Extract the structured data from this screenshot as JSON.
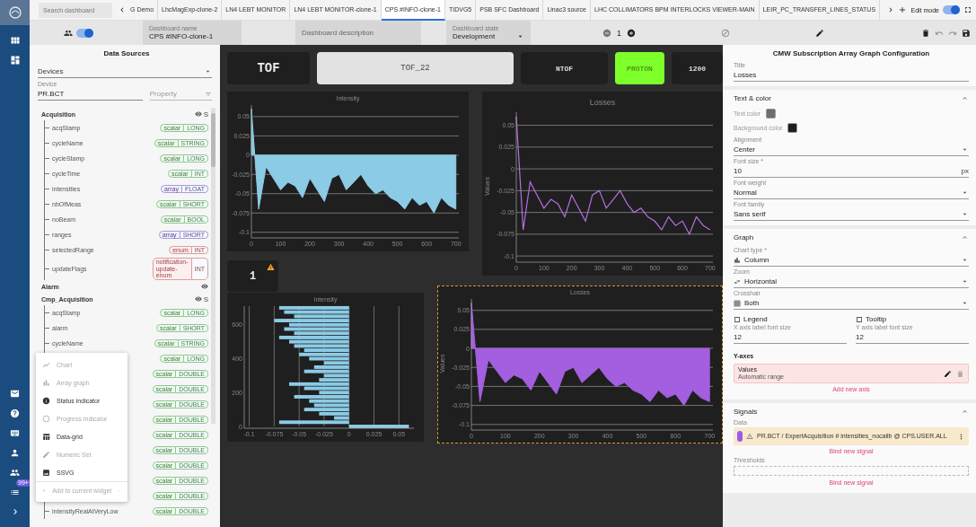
{
  "rail": {
    "badge": "99+"
  },
  "top_bar": {
    "search": {
      "placeholder": "Search dashboard"
    },
    "tabs": [
      {
        "label": "G Demo",
        "selected": false
      },
      {
        "label": "LhcMagExp-clone-2",
        "selected": false
      },
      {
        "label": "LN4 LEBT MONITOR",
        "selected": false
      },
      {
        "label": "LN4 LEBT MONITOR-clone-1",
        "selected": false
      },
      {
        "label": "CPS #INFO-clone-1",
        "selected": true
      },
      {
        "label": "TIDVG5",
        "selected": false
      },
      {
        "label": "PSB SFC Dashboard",
        "selected": false
      },
      {
        "label": "Linac3 source",
        "selected": false
      },
      {
        "label": "LHC COLLIMATORS BPM INTERLOCKS VIEWER-MAIN",
        "selected": false
      },
      {
        "label": "LEIR_PC_TRANSFER_LINES_STATUS",
        "selected": false
      }
    ],
    "edit_mode": {
      "label": "Edit mode",
      "on": true
    }
  },
  "dashboard_bar": {
    "shared": {
      "on": true
    },
    "name": {
      "label": "Dashboard name",
      "value": "CPS #INFO-clone-1"
    },
    "description": {
      "placeholder": "Dashboard description"
    },
    "state": {
      "label": "Dashboard state",
      "value": "Development"
    },
    "counter": "1"
  },
  "data_sources": {
    "title": "Data Sources",
    "source_type": "Devices",
    "device": {
      "label": "Device",
      "value": "PR.BCT"
    },
    "property": {
      "placeholder": "Property"
    },
    "groups": [
      {
        "name": "Acquisition",
        "mark": "S",
        "fields": [
          {
            "name": "acqStamp",
            "shape": "scalar",
            "type": "LONG",
            "kind": "scalar"
          },
          {
            "name": "cycleName",
            "shape": "scalar",
            "type": "STRING",
            "kind": "scalar"
          },
          {
            "name": "cycleStamp",
            "shape": "scalar",
            "type": "LONG",
            "kind": "scalar"
          },
          {
            "name": "cycleTime",
            "shape": "scalar",
            "type": "INT",
            "kind": "scalar"
          },
          {
            "name": "intensities",
            "shape": "array",
            "type": "FLOAT",
            "kind": "array"
          },
          {
            "name": "nbOfMeas",
            "shape": "scalar",
            "type": "SHORT",
            "kind": "scalar"
          },
          {
            "name": "noBeam",
            "shape": "scalar",
            "type": "BOOL",
            "kind": "scalar"
          },
          {
            "name": "ranges",
            "shape": "array",
            "type": "SHORT",
            "kind": "array"
          },
          {
            "name": "selectedRange",
            "shape": "enum",
            "type": "INT",
            "kind": "enum"
          },
          {
            "name": "updateFlags",
            "shape": "notification-update-enum",
            "type": "INT",
            "kind": "enum"
          }
        ]
      },
      {
        "name": "Alarm"
      },
      {
        "name": "Cmp_Acquisition",
        "mark": "S",
        "fields": [
          {
            "name": "acqStamp",
            "shape": "scalar",
            "type": "LONG",
            "kind": "scalar"
          },
          {
            "name": "alarm",
            "shape": "scalar",
            "type": "SHORT",
            "kind": "scalar"
          },
          {
            "name": "cycleName",
            "shape": "scalar",
            "type": "STRING",
            "kind": "scalar"
          },
          {
            "shape": "scalar",
            "type": "LONG",
            "kind": "scalar"
          },
          {
            "shape": "scalar",
            "type": "DOUBLE",
            "kind": "scalar"
          },
          {
            "shape": "scalar",
            "type": "DOUBLE",
            "kind": "scalar"
          },
          {
            "shape": "scalar",
            "type": "DOUBLE",
            "kind": "scalar"
          },
          {
            "shape": "scalar",
            "type": "DOUBLE",
            "kind": "scalar"
          },
          {
            "shape": "scalar",
            "type": "DOUBLE",
            "kind": "scalar"
          },
          {
            "shape": "scalar",
            "type": "DOUBLE",
            "kind": "scalar"
          },
          {
            "shape": "scalar",
            "type": "DOUBLE",
            "kind": "scalar"
          },
          {
            "shape": "scalar",
            "type": "DOUBLE",
            "kind": "scalar"
          },
          {
            "shape": "scalar",
            "type": "DOUBLE",
            "kind": "scalar"
          },
          {
            "name": "intensityRealAtVeryLow",
            "shape": "scalar",
            "type": "DOUBLE",
            "kind": "scalar"
          }
        ]
      }
    ],
    "widget_menu": [
      {
        "label": "Chart",
        "kind": "chart",
        "disabled": true
      },
      {
        "label": "Array graph",
        "kind": "array_graph",
        "disabled": true
      },
      {
        "label": "Status indicator",
        "kind": "status",
        "disabled": false
      },
      {
        "label": "Progress indicator",
        "kind": "progress",
        "disabled": true
      },
      {
        "label": "Data-grid",
        "kind": "grid",
        "disabled": false
      },
      {
        "label": "Numeric Set",
        "kind": "numeric",
        "disabled": true
      },
      {
        "label": "SSVG",
        "kind": "ssvg",
        "disabled": false
      },
      {
        "label": "Add to current widget",
        "kind": "add",
        "disabled": true
      }
    ]
  },
  "canvas": {
    "labels": [
      {
        "text": "TOF",
        "kind": "title"
      },
      {
        "text": "TOF_22",
        "kind": "light"
      },
      {
        "text": "NTOF",
        "kind": "dark"
      },
      {
        "text": "PROTON",
        "kind": "highlight"
      },
      {
        "text": "1200",
        "kind": "dark"
      }
    ],
    "counter_widget": {
      "value": "1",
      "warning": true
    },
    "charts": [
      {
        "selected": false,
        "chart_data": {
          "type": "area",
          "title": "Intensity",
          "grid": true,
          "xlim": [
            0,
            710
          ],
          "ylim": [
            -0.105,
            0.065
          ],
          "xticks": [
            0,
            100,
            200,
            300,
            400,
            500,
            600,
            700
          ],
          "yticks": [
            -0.1,
            -0.075,
            -0.05,
            -0.025,
            0,
            0.025,
            0.05
          ],
          "x": [
            0,
            25,
            50,
            75,
            100,
            125,
            150,
            175,
            200,
            225,
            250,
            275,
            300,
            325,
            350,
            375,
            400,
            425,
            450,
            475,
            500,
            525,
            550,
            575,
            600,
            625,
            650,
            675,
            700
          ],
          "series": [
            {
              "color": "#8ccbe6",
              "values": [
                0.06,
                -0.07,
                -0.015,
                -0.03,
                -0.045,
                -0.035,
                -0.04,
                -0.055,
                -0.03,
                -0.045,
                -0.06,
                -0.03,
                -0.025,
                -0.045,
                -0.035,
                -0.025,
                -0.04,
                -0.05,
                -0.045,
                -0.055,
                -0.06,
                -0.07,
                -0.055,
                -0.065,
                -0.06,
                -0.075,
                -0.055,
                -0.065,
                -0.07
              ]
            }
          ]
        }
      },
      {
        "selected": false,
        "chart_data": {
          "type": "line",
          "title": "Losses",
          "grid": true,
          "ylabel": "Values",
          "xlim": [
            0,
            710
          ],
          "ylim": [
            -0.105,
            0.065
          ],
          "xticks": [
            0,
            100,
            200,
            300,
            400,
            500,
            600,
            700
          ],
          "yticks": [
            -0.1,
            -0.075,
            -0.05,
            -0.025,
            0,
            0.025,
            0.05
          ],
          "x": [
            0,
            25,
            50,
            75,
            100,
            125,
            150,
            175,
            200,
            225,
            250,
            275,
            300,
            325,
            350,
            375,
            400,
            425,
            450,
            475,
            500,
            525,
            550,
            575,
            600,
            625,
            650,
            675,
            700
          ],
          "series": [
            {
              "color": "#b46fe0",
              "values": [
                0.06,
                -0.07,
                -0.015,
                -0.03,
                -0.045,
                -0.035,
                -0.04,
                -0.055,
                -0.03,
                -0.045,
                -0.06,
                -0.03,
                -0.025,
                -0.045,
                -0.035,
                -0.025,
                -0.04,
                -0.05,
                -0.045,
                -0.055,
                -0.06,
                -0.07,
                -0.055,
                -0.065,
                -0.06,
                -0.075,
                -0.055,
                -0.065,
                -0.07
              ]
            }
          ]
        }
      },
      {
        "selected": false,
        "chart_data": {
          "type": "bar",
          "orientation": "horizontal",
          "title": "Intensity",
          "grid": true,
          "xlim": [
            -0.105,
            0.065
          ],
          "ylim": [
            0,
            710
          ],
          "xticks": [
            -0.1,
            -0.075,
            -0.05,
            -0.025,
            0,
            0.025,
            0.05
          ],
          "yticks": [
            0,
            200,
            400,
            600
          ],
          "x": [
            0,
            25,
            50,
            75,
            100,
            125,
            150,
            175,
            200,
            225,
            250,
            275,
            300,
            325,
            350,
            375,
            400,
            425,
            450,
            475,
            500,
            525,
            550,
            575,
            600,
            625,
            650,
            675,
            700
          ],
          "series": [
            {
              "color": "#8ccbe6",
              "values": [
                0.06,
                -0.07,
                -0.015,
                -0.03,
                -0.045,
                -0.035,
                -0.04,
                -0.055,
                -0.03,
                -0.045,
                -0.06,
                -0.03,
                -0.025,
                -0.045,
                -0.035,
                -0.025,
                -0.04,
                -0.05,
                -0.045,
                -0.055,
                -0.06,
                -0.07,
                -0.055,
                -0.065,
                -0.06,
                -0.075,
                -0.055,
                -0.065,
                -0.07
              ]
            }
          ]
        }
      },
      {
        "selected": true,
        "chart_data": {
          "type": "area",
          "title": "Losses",
          "grid": true,
          "ylabel": "Values",
          "xlim": [
            0,
            710
          ],
          "ylim": [
            -0.105,
            0.065
          ],
          "xticks": [
            0,
            100,
            200,
            300,
            400,
            500,
            600,
            700
          ],
          "yticks": [
            -0.1,
            -0.075,
            -0.05,
            -0.025,
            0,
            0.025,
            0.05
          ],
          "x": [
            0,
            25,
            50,
            75,
            100,
            125,
            150,
            175,
            200,
            225,
            250,
            275,
            300,
            325,
            350,
            375,
            400,
            425,
            450,
            475,
            500,
            525,
            550,
            575,
            600,
            625,
            650,
            675,
            700
          ],
          "series": [
            {
              "color": "#a45ee0",
              "values": [
                0.06,
                -0.07,
                -0.015,
                -0.03,
                -0.045,
                -0.035,
                -0.04,
                -0.055,
                -0.03,
                -0.045,
                -0.06,
                -0.03,
                -0.025,
                -0.045,
                -0.035,
                -0.025,
                -0.04,
                -0.05,
                -0.045,
                -0.055,
                -0.06,
                -0.07,
                -0.055,
                -0.065,
                -0.06,
                -0.075,
                -0.055,
                -0.065,
                -0.07
              ]
            }
          ]
        }
      }
    ]
  },
  "config": {
    "title": "CMW Subscription Array Graph Configuration",
    "title_field": {
      "label": "Title",
      "value": "Losses"
    },
    "text_color": {
      "heading": "Text & color",
      "expanded": true,
      "text_color": {
        "label": "Text color",
        "color": "#6e6e6e"
      },
      "background_color": {
        "label": "Background color",
        "color": "#1e1e1e"
      },
      "alignment": {
        "label": "Alignment",
        "value": "Center"
      },
      "font_size": {
        "label": "Font size *",
        "value": "10",
        "unit": "px"
      },
      "font_weight": {
        "label": "Font weight",
        "value": "Normal"
      },
      "font_family": {
        "label": "Font family",
        "value": "Sans serif"
      }
    },
    "graph": {
      "heading": "Graph",
      "expanded": true,
      "chart_type": {
        "label": "Chart type *",
        "value": "Column"
      },
      "zoom": {
        "label": "Zoom",
        "value": "Horizontal"
      },
      "crosshair": {
        "label": "Crosshair",
        "value": "Both"
      },
      "legend": {
        "label": "Legend",
        "checked": false
      },
      "tooltip": {
        "label": "Tooltip",
        "checked": false
      },
      "x_font": {
        "label": "X axis label font size",
        "value": "12"
      },
      "y_font": {
        "label": "Y axis label font size",
        "value": "12"
      },
      "y_axes_heading": "Y-axes",
      "axes": [
        {
          "name": "Values",
          "range": "Automatic range"
        }
      ],
      "add_axis": "Add new axis"
    },
    "signals": {
      "heading": "Signals",
      "expanded": true,
      "data_label": "Data",
      "items": [
        {
          "text": "PR.BCT / ExpertAcquisition # intensities_nocalib @ CPS.USER.ALL",
          "color": "#9b5de5",
          "warning": true
        }
      ],
      "bind": "Bind new signal",
      "thresholds_label": "Thresholds",
      "bind_thresholds": "Bind new signal"
    }
  }
}
